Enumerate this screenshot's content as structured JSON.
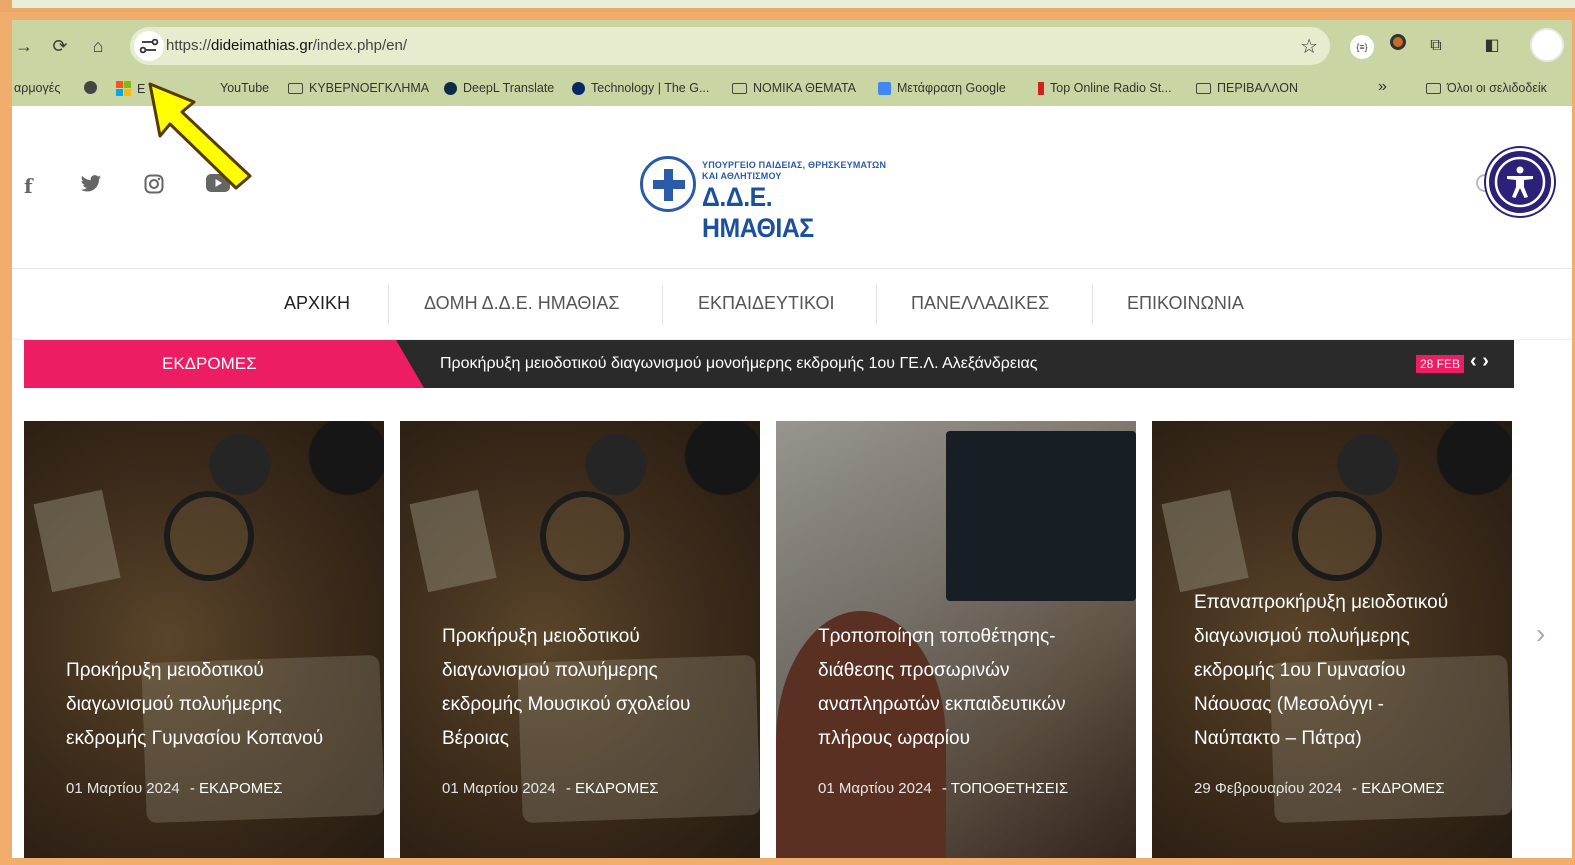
{
  "browser": {
    "url_prefix": "https://",
    "url_domain": "dideimathias.gr",
    "url_path": "/index.php/en/",
    "nav_icons": [
      "forward-icon",
      "reload-icon",
      "home-icon"
    ]
  },
  "bookmarks": [
    {
      "label": "αρμογές",
      "icon": "apps"
    },
    {
      "label": "",
      "icon": "globe"
    },
    {
      "label": "E",
      "icon": "microsoft"
    },
    {
      "label": "YouTube",
      "icon": "youtube"
    },
    {
      "label": "ΚΥΒΕΡΝΟΕΓΚΛΗΜΑ",
      "icon": "folder"
    },
    {
      "label": "DeepL Translate",
      "icon": "deepl"
    },
    {
      "label": "Technology | The G...",
      "icon": "guardian"
    },
    {
      "label": "ΝΟΜΙΚΑ ΘΕΜΑΤΑ",
      "icon": "folder"
    },
    {
      "label": "Μετάφραση Google",
      "icon": "translate"
    },
    {
      "label": "Top Online Radio St...",
      "icon": "radio"
    },
    {
      "label": "ΠΕΡΙΒΑΛΛΟΝ",
      "icon": "folder"
    },
    {
      "label": "»",
      "icon": ""
    },
    {
      "label": "Όλοι οι σελιδοδείκ",
      "icon": "folder"
    }
  ],
  "logo": {
    "line1": "ΥΠΟΥΡΓΕΙΟ ΠΑΙΔΕΙΑΣ, ΘΡΗΣΚΕΥΜΑΤΩΝ",
    "line2": "ΚΑΙ ΑΘΛΗΤΙΣΜΟΥ",
    "name": "Δ.Δ.Ε. ΗΜΑΘΙΑΣ"
  },
  "menu": [
    "ΑΡΧΙΚΗ",
    "ΔΟΜΗ Δ.Δ.Ε. ΗΜΑΘΙΑΣ",
    "ΕΚΠΑΙΔΕΥΤΙΚΟΙ",
    "ΠΑΝΕΛΛΑΔΙΚΕΣ",
    "ΕΠΙΚΟΙΝΩΝΙΑ"
  ],
  "ticker": {
    "label": "ΕΚΔΡΟΜΕΣ",
    "text": "Προκήρυξη μειοδοτικού διαγωνισμού μονοήμερης εκδρομής 1ου ΓΕ.Λ. Αλεξάνδρειας",
    "date": "28 FEB"
  },
  "cards": [
    {
      "title_lines": [
        "Προκήρυξη μειοδοτικού",
        "διαγωνισμού πολυήμερης",
        "εκδρομής Γυμνασίου Κοπανού"
      ],
      "date": "01 Μαρτίου 2024",
      "category": "ΕΚΔΡΟΜΕΣ"
    },
    {
      "title_lines": [
        "Προκήρυξη μειοδοτικού",
        "διαγωνισμού πολυήμερης",
        "εκδρομής Μουσικού σχολείου",
        "Βέροιας"
      ],
      "date": "01 Μαρτίου 2024",
      "category": "ΕΚΔΡΟΜΕΣ"
    },
    {
      "title_lines": [
        "Τροποποίηση τοποθέτησης-",
        "διάθεσης προσωρινών",
        "αναπληρωτών εκπαιδευτικών",
        "πλήρους ωραρίου"
      ],
      "date": "01 Μαρτίου 2024",
      "category": "ΤΟΠΟΘΕΤΗΣΕΙΣ"
    },
    {
      "title_lines": [
        "Επαναπροκήρυξη μειοδοτικού",
        "διαγωνισμού πολυήμερης",
        "εκδρομής 1ου Γυμνασίου",
        "Νάουσας (Μεσολόγγι -",
        "Ναύπακτο – Πάτρα)"
      ],
      "date": "29 Φεβρουαρίου 2024",
      "category": "ΕΚΔΡΟΜΕΣ"
    }
  ],
  "colors": {
    "accent": "#ec1d63",
    "ticker_bg": "#2a2a2a",
    "logo_blue": "#1c4f9c",
    "toolbar": "#c9d6a3",
    "annotation_arrow": "#ffff00"
  }
}
